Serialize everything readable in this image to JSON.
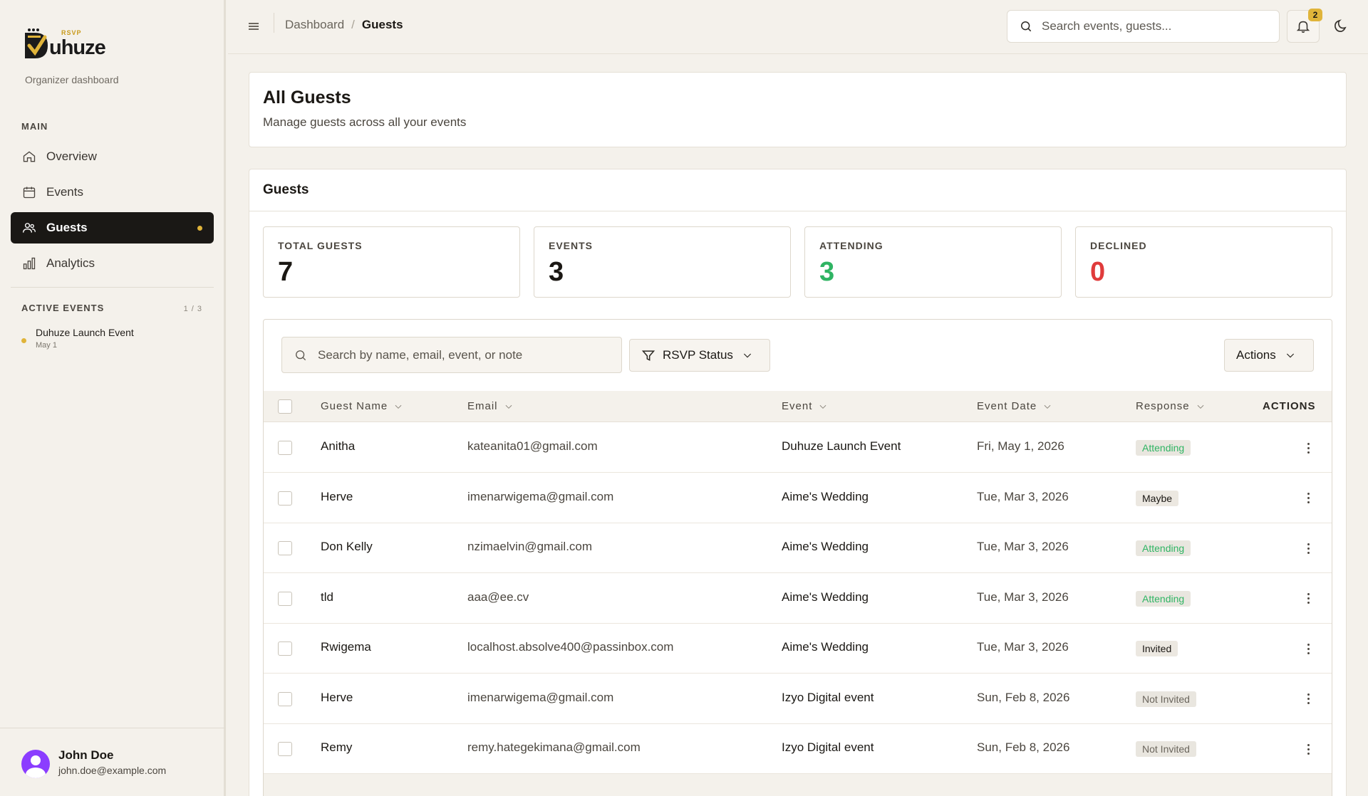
{
  "sidebar": {
    "brand": "uhuze",
    "brand_sub": "RSVP",
    "subtitle": "Organizer dashboard",
    "main_label": "MAIN",
    "nav": [
      {
        "label": "Overview",
        "icon": "home-icon"
      },
      {
        "label": "Events",
        "icon": "calendar-icon"
      },
      {
        "label": "Guests",
        "icon": "users-icon",
        "active": true
      },
      {
        "label": "Analytics",
        "icon": "bar-chart-icon"
      }
    ],
    "active_events_label": "ACTIVE EVENTS",
    "active_events_count": "1 / 3",
    "active_events": [
      {
        "name": "Duhuze Launch Event",
        "date": "May 1"
      }
    ],
    "user": {
      "name": "John Doe",
      "email": "john.doe@example.com"
    }
  },
  "topbar": {
    "breadcrumb": [
      "Dashboard",
      "Guests"
    ],
    "search_placeholder": "Search events, guests...",
    "notification_count": "2"
  },
  "page": {
    "title": "All Guests",
    "subtitle": "Manage guests across all your events"
  },
  "guests_card": {
    "heading": "Guests",
    "stats": [
      {
        "label": "TOTAL GUESTS",
        "value": "7",
        "color": "#1b1814"
      },
      {
        "label": "EVENTS",
        "value": "3",
        "color": "#1b1814"
      },
      {
        "label": "ATTENDING",
        "value": "3",
        "color": "#2fb463"
      },
      {
        "label": "DECLINED",
        "value": "0",
        "color": "#e03b3b"
      }
    ],
    "search_placeholder": "Search by name, email, event, or note",
    "rsvp_filter_label": "RSVP Status",
    "actions_label": "Actions",
    "columns": [
      "Guest Name",
      "Email",
      "Event",
      "Event Date",
      "Response",
      "ACTIONS"
    ],
    "rows": [
      {
        "name": "Anitha",
        "email": "kateanita01@gmail.com",
        "event": "Duhuze Launch Event",
        "date": "Fri, May 1, 2026",
        "response": "Attending"
      },
      {
        "name": "Herve",
        "email": "imenarwigema@gmail.com",
        "event": "Aime's Wedding",
        "date": "Tue, Mar 3, 2026",
        "response": "Maybe"
      },
      {
        "name": "Don Kelly",
        "email": "nzimaelvin@gmail.com",
        "event": "Aime's Wedding",
        "date": "Tue, Mar 3, 2026",
        "response": "Attending"
      },
      {
        "name": "tld",
        "email": "aaa@ee.cv",
        "event": "Aime's Wedding",
        "date": "Tue, Mar 3, 2026",
        "response": "Attending"
      },
      {
        "name": "Rwigema",
        "email": "localhost.absolve400@passinbox.com",
        "event": "Aime's Wedding",
        "date": "Tue, Mar 3, 2026",
        "response": "Invited"
      },
      {
        "name": "Herve",
        "email": "imenarwigema@gmail.com",
        "event": "Izyo Digital event",
        "date": "Sun, Feb 8, 2026",
        "response": "Not Invited"
      },
      {
        "name": "Remy",
        "email": "remy.hategekimana@gmail.com",
        "event": "Izyo Digital event",
        "date": "Sun, Feb 8, 2026",
        "response": "Not Invited"
      }
    ],
    "response_styles": {
      "Attending": {
        "bg": "#e9e6df",
        "fg": "#2fb463"
      },
      "Maybe": {
        "bg": "#ece8e1",
        "fg": "#1b1814"
      },
      "Invited": {
        "bg": "#ece8e1",
        "fg": "#1b1814"
      },
      "Not Invited": {
        "bg": "#e9e6df",
        "fg": "#6a655c"
      }
    }
  }
}
